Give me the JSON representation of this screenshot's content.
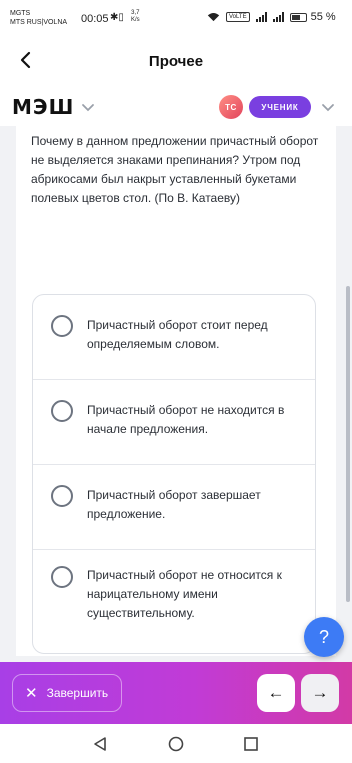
{
  "status_bar": {
    "carrier_1": "MGTS",
    "carrier_2": "MTS RUS|VOLNA",
    "time": "00:05",
    "speed_value": "3,7",
    "speed_unit": "K/s",
    "volte": "VoLTE",
    "battery": "55 %",
    "battery_level": 0.55
  },
  "header": {
    "title": "Прочее"
  },
  "mesh_bar": {
    "logo": "МЭШ",
    "avatar_initials": "ТС",
    "role": "УЧЕНИК"
  },
  "question": {
    "text": "Почему в данном предложении причастный оборот не выделяется знаками препинания? Утром под абрикосами был накрыт уставленный букетами полевых цветов стол. (По В. Катаеву)"
  },
  "options": [
    {
      "text": "Причастный оборот стоит перед определяемым словом."
    },
    {
      "text": "Причастный оборот не находится в начале предложения."
    },
    {
      "text": "Причастный оборот завершает предложение."
    },
    {
      "text": "Причастный оборот не относится к нарицательному имени существительному."
    }
  ],
  "help_button": {
    "label": "?"
  },
  "action_bar": {
    "finish_label": "Завершить",
    "prev_label": "←",
    "next_label": "→"
  },
  "colors": {
    "accent_purple": "#7a3fe0",
    "help_blue": "#3d7bf5",
    "action_gradient_start": "#a83fe6",
    "action_gradient_end": "#d23aa6"
  }
}
